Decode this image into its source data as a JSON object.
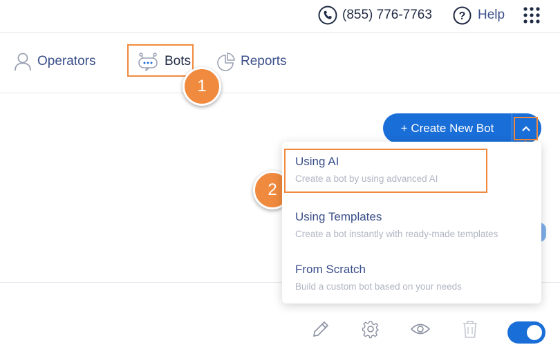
{
  "header": {
    "phone": "(855) 776-7763",
    "help": "Help"
  },
  "nav": {
    "operators": "Operators",
    "bots": "Bots",
    "reports": "Reports"
  },
  "steps": [
    "1",
    "2"
  ],
  "create_button": {
    "label": "+ Create New Bot"
  },
  "dropdown": {
    "options": [
      {
        "title": "Using AI",
        "desc": "Create a bot by using advanced AI"
      },
      {
        "title": "Using Templates",
        "desc": "Create a bot instantly with ready-made templates"
      },
      {
        "title": "From Scratch",
        "desc": "Build a custom bot based on your needs"
      }
    ]
  },
  "actions": [
    "edit-icon",
    "settings-icon",
    "preview-icon",
    "delete-icon"
  ],
  "colors": {
    "accent": "#1a6ed8",
    "highlight": "#f08a3e",
    "nav_text": "#3a4f8a"
  }
}
